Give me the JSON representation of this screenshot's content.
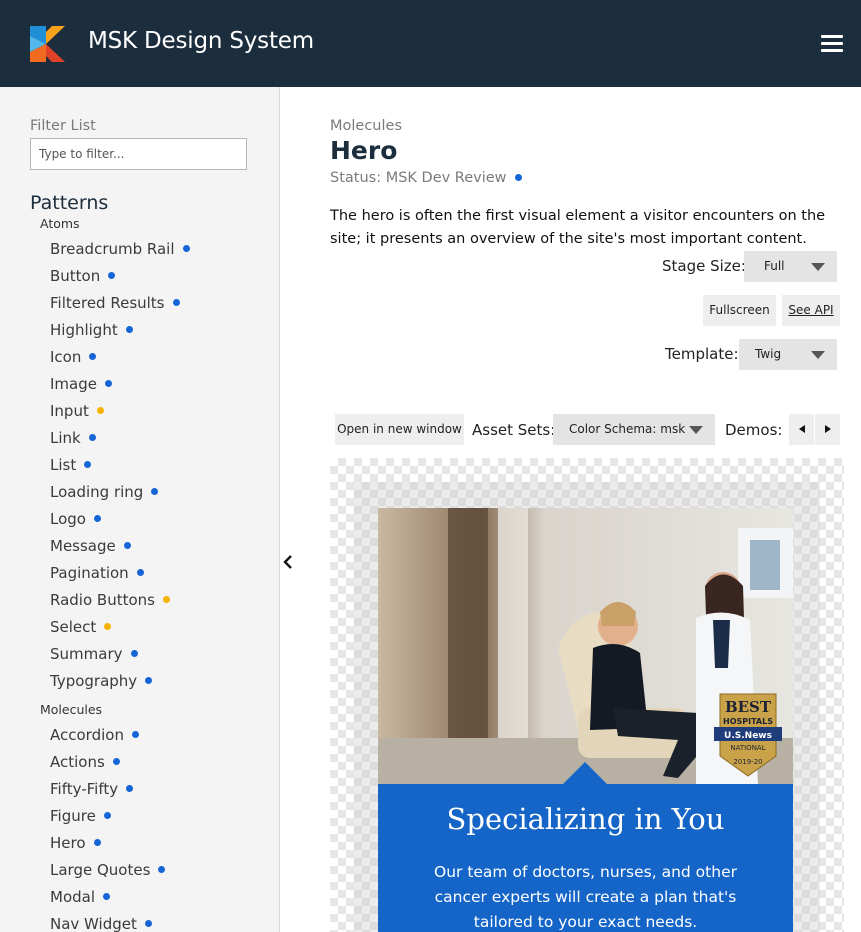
{
  "header": {
    "brand": "MSK Design System",
    "logo_icon": "msk-k-logo-icon",
    "menu_icon": "hamburger-menu-icon"
  },
  "sidebar": {
    "filter_label": "Filter List",
    "filter_placeholder": "Type to filter...",
    "patterns_title": "Patterns",
    "groups": [
      {
        "title": "Atoms",
        "items": [
          {
            "label": "Breadcrumb Rail",
            "status": "blue"
          },
          {
            "label": "Button",
            "status": "blue"
          },
          {
            "label": "Filtered Results",
            "status": "blue"
          },
          {
            "label": "Highlight",
            "status": "blue"
          },
          {
            "label": "Icon",
            "status": "blue"
          },
          {
            "label": "Image",
            "status": "blue"
          },
          {
            "label": "Input",
            "status": "yellow"
          },
          {
            "label": "Link",
            "status": "blue"
          },
          {
            "label": "List",
            "status": "blue"
          },
          {
            "label": "Loading ring",
            "status": "blue"
          },
          {
            "label": "Logo",
            "status": "blue"
          },
          {
            "label": "Message",
            "status": "blue"
          },
          {
            "label": "Pagination",
            "status": "blue"
          },
          {
            "label": "Radio Buttons",
            "status": "yellow"
          },
          {
            "label": "Select",
            "status": "yellow"
          },
          {
            "label": "Summary",
            "status": "blue"
          },
          {
            "label": "Typography",
            "status": "blue"
          }
        ]
      },
      {
        "title": "Molecules",
        "items": [
          {
            "label": "Accordion",
            "status": "blue"
          },
          {
            "label": "Actions",
            "status": "blue"
          },
          {
            "label": "Fifty-Fifty",
            "status": "blue"
          },
          {
            "label": "Figure",
            "status": "blue"
          },
          {
            "label": "Hero",
            "status": "blue"
          },
          {
            "label": "Large Quotes",
            "status": "blue"
          },
          {
            "label": "Modal",
            "status": "blue"
          },
          {
            "label": "Nav Widget",
            "status": "blue"
          }
        ]
      }
    ]
  },
  "colors": {
    "status_blue": "#1565d8",
    "status_yellow": "#f5b301",
    "header_bg": "#1c2d3d",
    "hero_blue": "#1565c8"
  },
  "main": {
    "breadcrumb": "Molecules",
    "title": "Hero",
    "status": "Status: MSK Dev Review",
    "description": "The hero is often the first visual element a visitor encounters on the site; it presents an overview of the site's most important content.",
    "stage_size_label": "Stage Size:",
    "stage_size_value": "Full",
    "fullscreen_label": "Fullscreen",
    "see_api_label": "See API",
    "template_label": "Template:",
    "template_value": "Twig",
    "open_window_label": "Open in new window",
    "asset_sets_label": "Asset Sets:",
    "asset_sets_value": "Color Schema: msk",
    "demos_label": "Demos:",
    "demo_prev_icon": "triangle-left-icon",
    "demo_next_icon": "triangle-right-icon",
    "collapse_icon": "chevron-left-icon"
  },
  "hero": {
    "title": "Specializing in You",
    "body": "Our team of doctors, nurses, and other cancer experts will create a plan that's tailored to your exact needs.",
    "badge_best": "BEST",
    "badge_hospitals": "HOSPITALS",
    "badge_usnews": "U.S.News",
    "badge_national": "NATIONAL",
    "badge_years": "2019-20"
  }
}
